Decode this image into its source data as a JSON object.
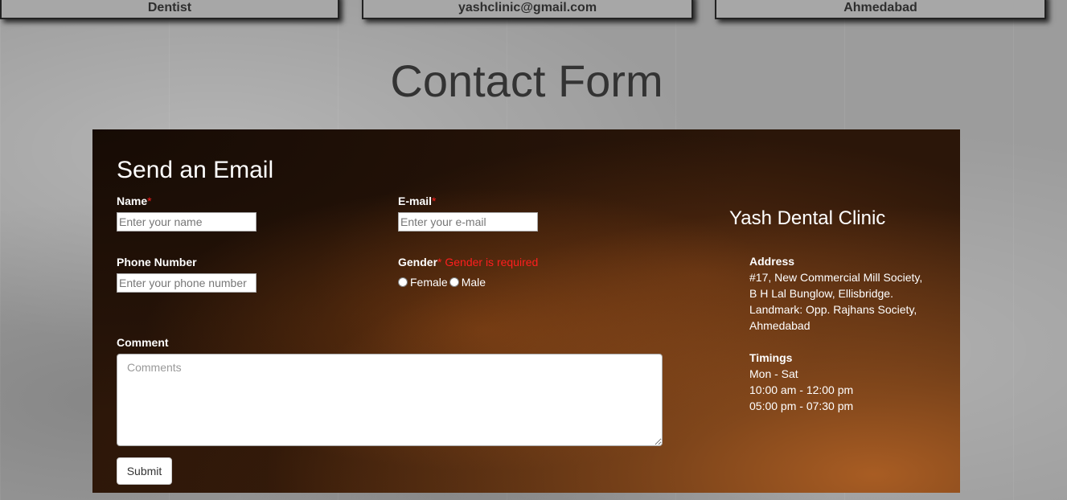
{
  "top_boxes": [
    "Dentist",
    "yashclinic@gmail.com",
    "Ahmedabad"
  ],
  "page_title": "Contact Form",
  "form": {
    "heading": "Send an Email",
    "name": {
      "label": "Name",
      "required_mark": "*",
      "placeholder": "Enter your name"
    },
    "email": {
      "label": "E-mail",
      "required_mark": "*",
      "placeholder": "Enter your e-mail"
    },
    "phone": {
      "label": "Phone Number",
      "placeholder": "Enter your phone number"
    },
    "gender": {
      "label": "Gender",
      "required_mark": "*",
      "error": "Gender is required",
      "options": [
        "Female",
        "Male"
      ]
    },
    "comment": {
      "label": "Comment",
      "placeholder": "Comments"
    },
    "submit_label": "Submit"
  },
  "clinic": {
    "name": "Yash Dental Clinic",
    "address_title": "Address",
    "address_lines": [
      "#17, New Commercial Mill Society,",
      "B H Lal Bunglow, Ellisbridge.",
      "Landmark: Opp. Rajhans Society,",
      "Ahmedabad"
    ],
    "timings_title": "Timings",
    "timings_lines": [
      "Mon - Sat",
      "10:00 am - 12:00 pm",
      "05:00 pm - 07:30 pm"
    ]
  },
  "colors": {
    "required": "#ff1e1e",
    "panel_bg": "#2b1609",
    "page_bg": "#9c9c9c"
  }
}
